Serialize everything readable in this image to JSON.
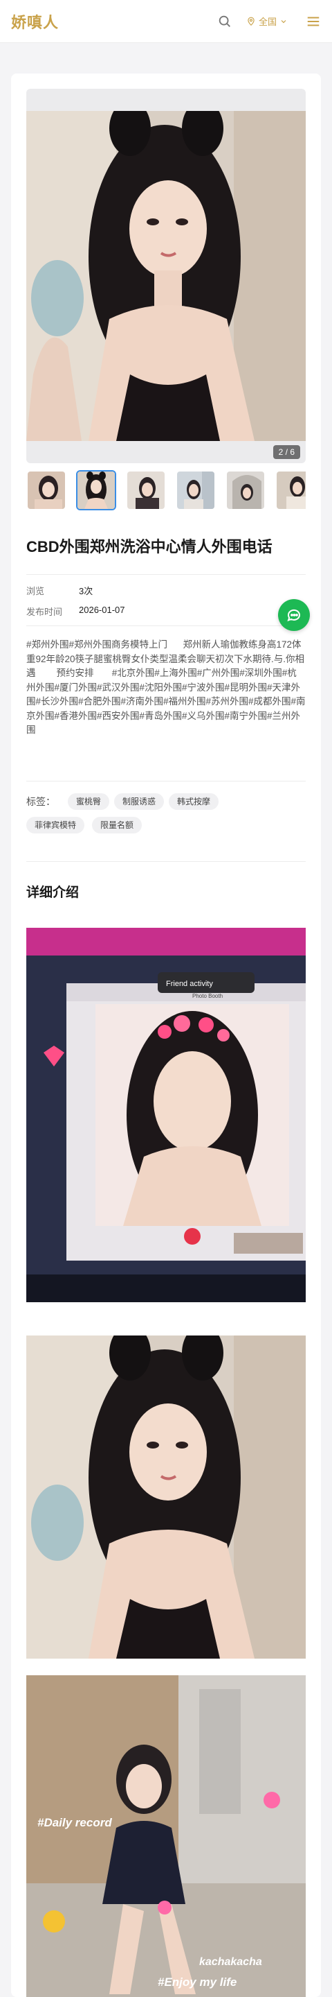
{
  "header": {
    "logo": "娇嗔人",
    "location": "全国"
  },
  "gallery": {
    "counter": "2 / 6",
    "thumbs": [
      "thumb-1",
      "thumb-2",
      "thumb-3",
      "thumb-4",
      "thumb-5",
      "thumb-6"
    ],
    "active_thumb": 2
  },
  "post": {
    "title": "CBD外围郑州洗浴中心情人外围电话",
    "views_label": "浏览",
    "views_value": "3次",
    "date_label": "发布时间",
    "date_value": "2026-01-07",
    "description": "#郑州外围#郑州外围商务模特上门      郑州新人瑜伽教练身高172体重92年龄20筷子腿蜜桃臀女仆类型温柔会聊天初次下水期待.与.你相遇        预约安排       #北京外围#上海外围#广州外围#深圳外围#杭州外围#厦门外围#武汉外围#沈阳外围#宁波外围#昆明外围#天津外围#长沙外围#合肥外围#济南外围#福州外围#苏州外围#成都外围#南京外围#香港外围#西安外围#青岛外围#义乌外围#南宁外围#兰州外围"
  },
  "tags": {
    "label": "标签：",
    "items": [
      "蜜桃臀",
      "制服诱惑",
      "韩式按摩",
      "菲律宾模特",
      "限量名额"
    ]
  },
  "detail": {
    "title": "详细介绍",
    "photo2_app": "Friend activity",
    "photo2_booth": "Photo Booth",
    "photo4_caption1": "#Daily record",
    "photo4_caption2": "kachakacha",
    "photo4_caption3": "#Enjoy my life"
  },
  "colors": {
    "brand_gold": "#c9a24a",
    "accent_blue": "#3a8ee6",
    "chat_green": "#1db954"
  }
}
